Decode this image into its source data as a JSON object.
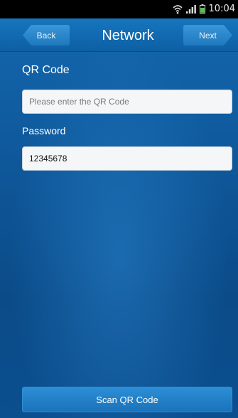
{
  "status_bar": {
    "time": "10:04",
    "icons": [
      "wifi-icon",
      "signal-icon",
      "battery-icon"
    ],
    "battery_color": "#4cc742"
  },
  "header": {
    "title": "Network",
    "back_label": "Back",
    "next_label": "Next"
  },
  "form": {
    "qr_label": "QR Code",
    "qr_placeholder": "Please enter the QR Code",
    "qr_value": "",
    "password_label": "Password",
    "password_value": "12345678"
  },
  "actions": {
    "scan_label": "Scan QR Code"
  },
  "colors": {
    "background": "#0d4f8c",
    "header": "#1676bf",
    "button": "#2c8ed6",
    "field": "#f5f6f7"
  }
}
